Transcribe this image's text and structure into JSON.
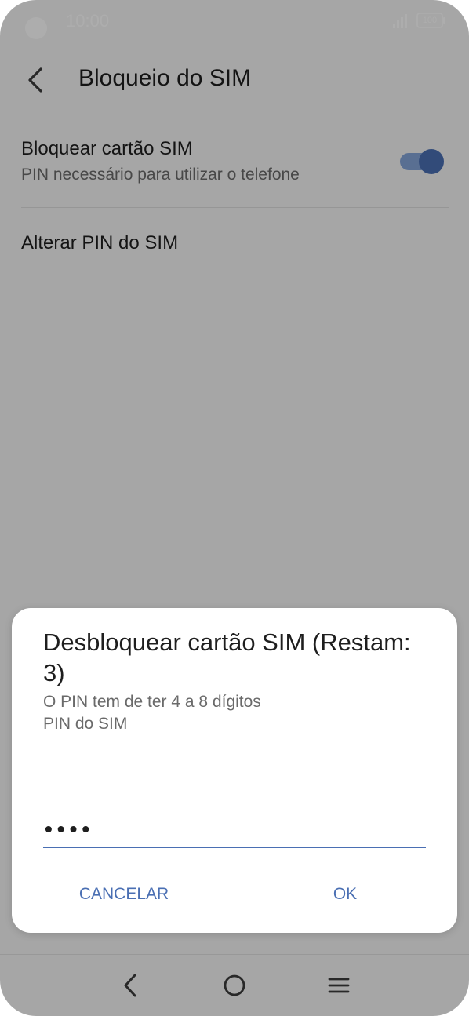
{
  "status_bar": {
    "time": "10:00",
    "battery": "100"
  },
  "header": {
    "title": "Bloqueio do SIM"
  },
  "settings": {
    "sim_lock": {
      "title": "Bloquear cartão SIM",
      "subtitle": "PIN necessário para utilizar o telefone",
      "enabled": true
    },
    "change_pin": {
      "title": "Alterar PIN do SIM"
    }
  },
  "dialog": {
    "title": "Desbloquear cartão SIM (Restam: 3)",
    "hint": "O PIN tem de ter 4 a 8 dígitos",
    "label": "PIN do SIM",
    "pin_masked": "••••",
    "cancel_label": "CANCELAR",
    "ok_label": "OK"
  },
  "colors": {
    "accent": "#4a6fb3",
    "scrim": "rgba(0,0,0,0.32)"
  },
  "icons": {
    "back": "back-arrow-icon",
    "signal": "signal-icon",
    "battery": "battery-icon",
    "nav_back": "nav-back-icon",
    "nav_home": "nav-home-icon",
    "nav_menu": "nav-menu-icon"
  }
}
